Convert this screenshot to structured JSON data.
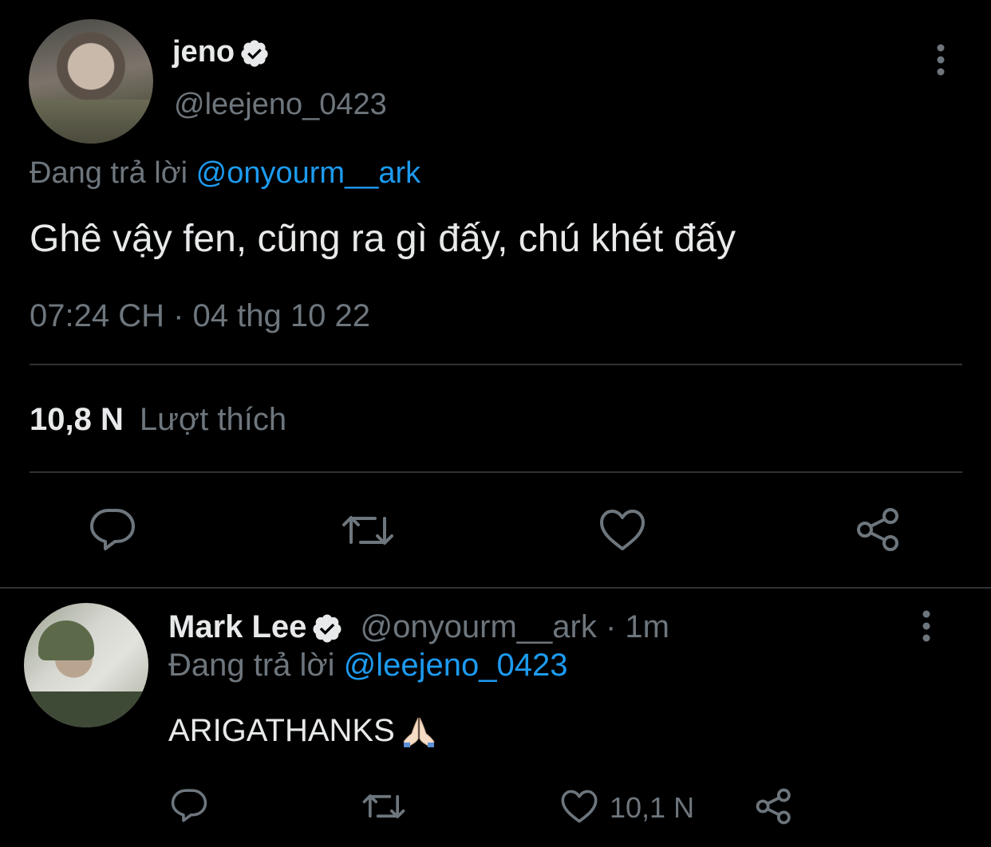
{
  "tweet": {
    "display_name": "jeno",
    "handle": "@leejeno_0423",
    "replying_prefix": "Đang trả lời",
    "replying_to": "@onyourm__ark",
    "text": "Ghê vậy fen, cũng ra gì đấy, chú khét đấy",
    "timestamp": "07:24 CH · 04 thg 10 22",
    "likes_count": "10,8 N",
    "likes_label": "Lượt thích"
  },
  "reply": {
    "display_name": "Mark Lee",
    "handle": "@onyourm__ark",
    "separator": "·",
    "time": "1m",
    "replying_prefix": "Đang trả lời",
    "replying_to": "@leejeno_0423",
    "text": "ARIGATHANKS",
    "emoji": "folded-hands",
    "like_count": "10,1 N"
  },
  "colors": {
    "background": "#000000",
    "text": "#e7e9ea",
    "muted": "#6e767d",
    "accent": "#1d9bf0",
    "divider": "#2f3336"
  },
  "icons": [
    "verified-badge-icon",
    "more-options-icon",
    "reply-icon",
    "retweet-icon",
    "like-icon",
    "share-icon"
  ]
}
